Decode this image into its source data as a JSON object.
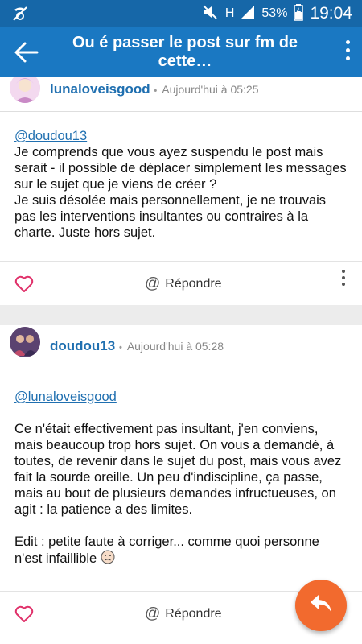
{
  "status_bar": {
    "battery": "53%",
    "network": "H",
    "time": "19:04"
  },
  "app_bar": {
    "title": "Ou é passer le post sur fm de cette…"
  },
  "posts": [
    {
      "author": "lunaloveisgood",
      "time": "Aujourd'hui à 05:25",
      "mention": "@doudou13",
      "paragraphs": [
        "Je comprends que vous ayez suspendu le post mais serait - il possible de déplacer simplement les messages sur le sujet que je viens de créer ?",
        "Je suis désolée mais personnellement, je ne trouvais pas les interventions insultantes ou contraires à la charte. Juste hors sujet."
      ],
      "reply_label": "Répondre"
    },
    {
      "author": "doudou13",
      "time": "Aujourd'hui à 05:28",
      "mention": "@lunaloveisgood",
      "paragraphs": [
        "Ce n'était effectivement pas insultant, j'en conviens, mais beaucoup trop hors sujet. On vous a demandé, à toutes, de revenir dans le sujet du post, mais vous avez fait la sourde oreille. Un peu d'indiscipline, ça passe, mais au bout de plusieurs demandes infructueuses, on agit : la patience a des limites.",
        "Edit : petite faute à corriger... comme quoi personne n'est infaillible"
      ],
      "reply_label": "Répondre"
    }
  ],
  "icons": {
    "back": "arrow-left-icon",
    "more": "more-vert-icon",
    "like": "heart-outline-icon",
    "emoji": "sad-face-icon",
    "fab": "reply-icon"
  },
  "colors": {
    "status_bar": "#1667a8",
    "app_bar": "#1a78c2",
    "link": "#1f6fb0",
    "fab": "#f26a2e"
  }
}
